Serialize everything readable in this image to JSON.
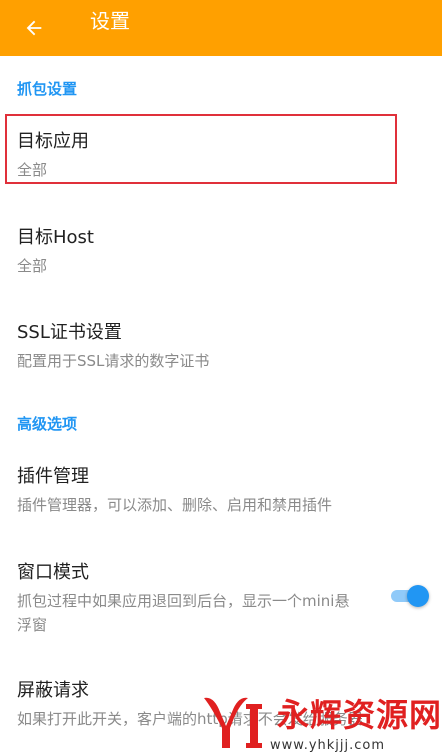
{
  "appbar": {
    "title": "设置",
    "back_icon": "arrow-left-icon",
    "bg": "#FFA000"
  },
  "sections": [
    {
      "header": "抓包设置"
    },
    {
      "header": "高级选项"
    }
  ],
  "prefs": {
    "target_app": {
      "title": "目标应用",
      "summary": "全部"
    },
    "target_host": {
      "title": "目标Host",
      "summary": "全部"
    },
    "ssl": {
      "title": "SSL证书设置",
      "summary": "配置用于SSL请求的数字证书"
    },
    "plugins": {
      "title": "插件管理",
      "summary": "插件管理器，可以添加、删除、启用和禁用插件"
    },
    "window_mode": {
      "title": "窗口模式",
      "summary": "抓包过程中如果应用退回到后台，显示一个mini悬浮窗",
      "enabled": true
    },
    "block_request": {
      "title": "屏蔽请求",
      "summary": "如果打开此开关，客户端的http请求不会发给服务器"
    }
  },
  "watermark": {
    "text": "永辉资源网",
    "url": "www.yhkjjj.com"
  },
  "colors": {
    "accent": "#2196F3",
    "highlight": "#e0303a"
  }
}
